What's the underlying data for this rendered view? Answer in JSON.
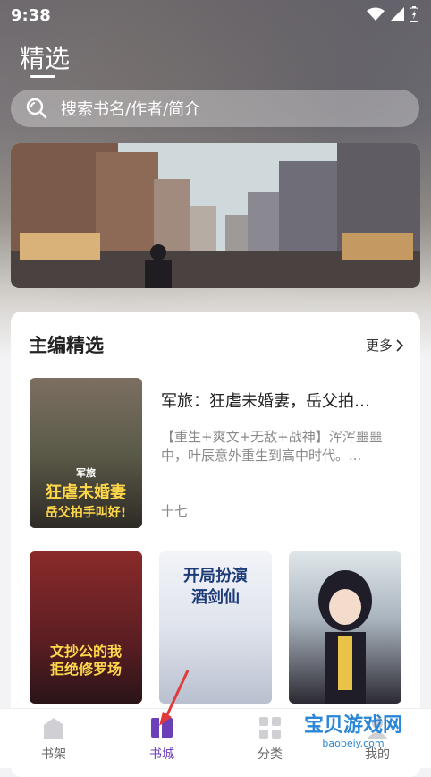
{
  "status": {
    "time": "9:38"
  },
  "header": {
    "title": "精选"
  },
  "search": {
    "placeholder": "搜索书名/作者/简介"
  },
  "section": {
    "title": "主编精选",
    "more_label": "更多",
    "featured": {
      "title": "军旅：狂虐未婚妻，岳父拍…",
      "description": "【重生+爽文+无敌+战神】浑浑噩噩中，叶辰意外重生到高中时代。...",
      "author": "十七",
      "cover_text": [
        "军旅",
        "狂虐未婚妻",
        "岳父拍手叫好!"
      ]
    },
    "books": [
      {
        "cover_text": [
          "文抄公的我",
          "拒绝修罗场"
        ]
      },
      {
        "cover_text": [
          "开局扮演",
          "酒剑仙"
        ]
      },
      {
        "cover_text": []
      }
    ]
  },
  "tabbar": {
    "items": [
      {
        "label": "书架"
      },
      {
        "label": "书城"
      },
      {
        "label": "分类"
      },
      {
        "label": "我的"
      }
    ],
    "active_index": 1,
    "active_color": "#6b3fb8"
  },
  "watermark": {
    "text": "宝贝游戏网",
    "sub": "baobeiy.com"
  }
}
